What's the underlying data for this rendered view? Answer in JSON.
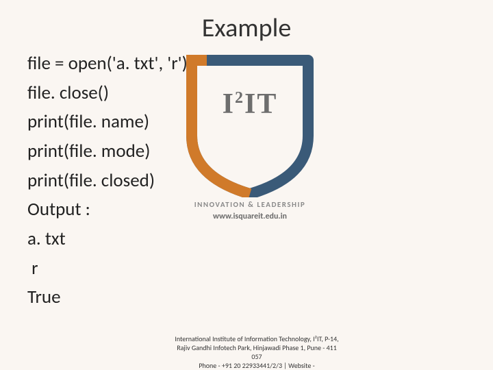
{
  "title": "Example",
  "code": {
    "l1": "file = open('a. txt', 'r')",
    "l2": "file. close()",
    "l3": "print(file. name)",
    "l4": "print(file. mode)",
    "l5": "print(file. closed)",
    "l6": "Output :",
    "l7": "a. txt",
    "l8": " r",
    "l9": "True"
  },
  "logo": {
    "text_prefix": "I",
    "text_sup": "2",
    "text_suffix": "IT",
    "tagline": "INNOVATION & LEADERSHIP",
    "website": "www.isquareit.edu.in",
    "shield_color": "#3a5a78",
    "accent_color": "#d07a2a"
  },
  "footer": {
    "line1": "International Institute of Information Technology, I²IT, P-14, Rajiv Gandhi Infotech Park, Hinjawadi Phase 1, Pune - 411 057",
    "line2": "Phone - +91 20 22933441/2/3 | Website -"
  }
}
